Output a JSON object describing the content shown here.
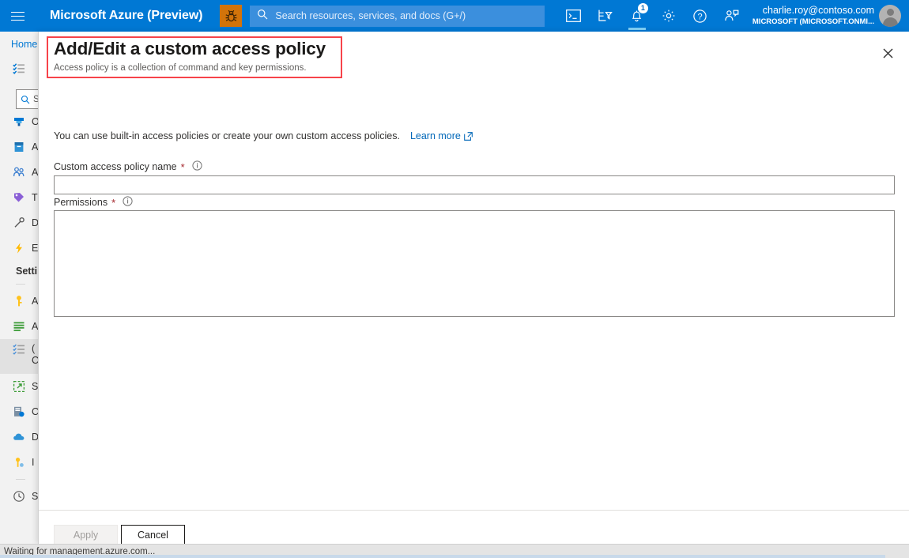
{
  "header": {
    "menu_icon": "hamburger-icon",
    "brand": "Microsoft Azure (Preview)",
    "bug_icon": "bug-icon",
    "search": {
      "icon": "search-icon",
      "placeholder": "Search resources, services, and docs (G+/)",
      "value": ""
    },
    "icons": [
      {
        "name": "cloud-shell-icon",
        "label": ">_"
      },
      {
        "name": "directory-filter-icon",
        "label": ""
      },
      {
        "name": "notifications-bell-icon",
        "label": "",
        "badge": "1"
      },
      {
        "name": "settings-gear-icon",
        "label": ""
      },
      {
        "name": "help-question-icon",
        "label": "?"
      },
      {
        "name": "feedback-person-icon",
        "label": ""
      }
    ],
    "user": {
      "email": "charlie.roy@contoso.com",
      "tenant": "MICROSOFT (MICROSOFT.ONMI...",
      "avatar": "user-avatar"
    },
    "accent_color": "#0078d4"
  },
  "sidebar": {
    "breadcrumb": "Home",
    "search_placeholder": "S",
    "top_items": [
      {
        "icon": "checklist-icon",
        "label": ""
      }
    ],
    "resource_items": [
      {
        "icon": "resource-group-icon",
        "label": "O"
      },
      {
        "icon": "book-icon",
        "label": "A"
      },
      {
        "icon": "users-icon",
        "label": "A"
      },
      {
        "icon": "tag-icon",
        "label": "T"
      },
      {
        "icon": "wrench-icon",
        "label": "D"
      },
      {
        "icon": "lightning-icon",
        "label": "E"
      }
    ],
    "settings_title": "Setti",
    "settings_items": [
      {
        "icon": "key-yellow-icon",
        "label": "A",
        "selected": false
      },
      {
        "icon": "list-green-icon",
        "label": "A",
        "selected": false
      },
      {
        "icon": "access-policy-icon",
        "label": "(",
        "sublabel": "C",
        "selected": true
      },
      {
        "icon": "export-icon",
        "label": "S",
        "selected": false
      },
      {
        "icon": "server-data-icon",
        "label": "C",
        "selected": false
      },
      {
        "icon": "cloud-blue-icon",
        "label": "D",
        "selected": false
      },
      {
        "icon": "key-small-icon",
        "label": "I",
        "selected": false
      },
      {
        "icon": "clock-icon",
        "label": "S",
        "selected": false
      }
    ]
  },
  "blade": {
    "title": "Add/Edit a custom access policy",
    "subtitle": "Access policy is a collection of command and key permissions.",
    "close_icon": "close-icon",
    "annotation_color": "#f7434a",
    "intro_text": "You can use built-in access policies or create your own custom access policies.",
    "learn_more": {
      "label": "Learn more",
      "icon": "external-link-icon"
    },
    "fields": {
      "name": {
        "label": "Custom access policy name",
        "required_marker": "*",
        "info_icon": "info-icon",
        "value": "",
        "placeholder": ""
      },
      "permissions": {
        "label": "Permissions",
        "required_marker": "*",
        "info_icon": "info-icon",
        "value": "",
        "placeholder": ""
      }
    },
    "footer": {
      "apply_label": "Apply",
      "apply_disabled": true,
      "cancel_label": "Cancel"
    }
  },
  "statusbar": {
    "text": "Waiting for management.azure.com..."
  }
}
